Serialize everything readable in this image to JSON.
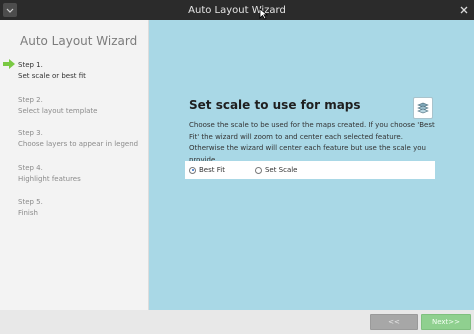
{
  "window": {
    "title": "Auto Layout Wizard"
  },
  "sidebar": {
    "title": "Auto Layout Wizard",
    "steps": [
      {
        "number": "Step 1.",
        "label": "Set scale or best fit",
        "active": true
      },
      {
        "number": "Step 2.",
        "label": "Select layout template",
        "active": false
      },
      {
        "number": "Step 3.",
        "label": "Choose layers to appear in legend",
        "active": false
      },
      {
        "number": "Step 4.",
        "label": "Highlight features",
        "active": false
      },
      {
        "number": "Step 5.",
        "label": "Finish",
        "active": false
      }
    ]
  },
  "main": {
    "title": "Set scale to use for maps",
    "icon": "layers-icon",
    "description": "Choose the scale to be used for the maps created. If you choose 'Best Fit' the wizard will zoom to and center each selected feature. Otherwise the wizard will center each feature but use the scale you provide.",
    "options": [
      {
        "label": "Best Fit",
        "selected": true
      },
      {
        "label": "Set Scale",
        "selected": false
      }
    ]
  },
  "buttons": {
    "back": "<<",
    "next": "Next>>"
  },
  "colors": {
    "main_bg": "#a9d8e6",
    "sidebar_bg": "#f3f3f3",
    "next_button": "#8fd08f",
    "back_button": "#a7a7a7",
    "active_arrow": "#7ac943"
  }
}
